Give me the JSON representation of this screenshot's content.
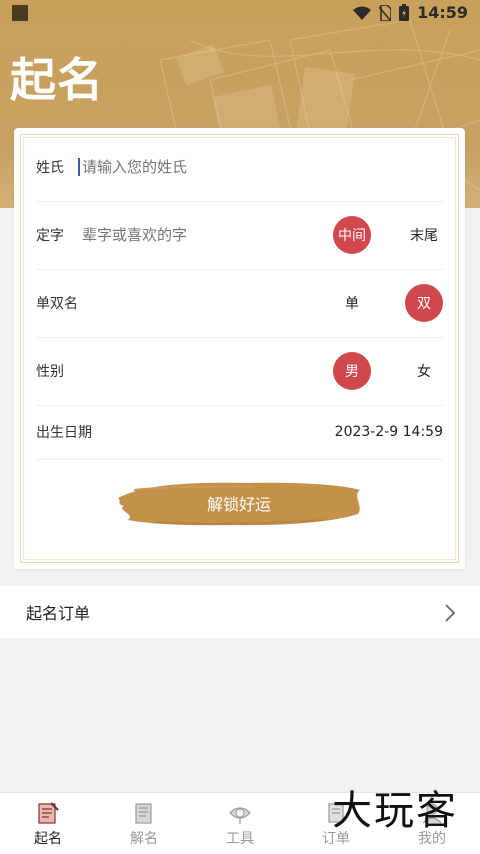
{
  "status_bar": {
    "time": "14:59"
  },
  "header": {
    "title": "起名"
  },
  "form": {
    "surname": {
      "label": "姓氏",
      "placeholder": "请输入您的姓氏"
    },
    "fixed_char": {
      "label": "定字",
      "placeholder": "辈字或喜欢的字",
      "options": [
        "中间",
        "末尾"
      ],
      "selected": "中间"
    },
    "name_length": {
      "label": "单双名",
      "options": [
        "单",
        "双"
      ],
      "selected": "双"
    },
    "gender": {
      "label": "性别",
      "options": [
        "男",
        "女"
      ],
      "selected": "男"
    },
    "birth": {
      "label": "出生日期",
      "value": "2023-2-9 14:59"
    },
    "submit_label": "解锁好运"
  },
  "orders": {
    "label": "起名订单"
  },
  "tabs": [
    {
      "label": "起名",
      "icon": "naming-scroll-icon",
      "active": true
    },
    {
      "label": "解名",
      "icon": "book-icon",
      "active": false
    },
    {
      "label": "工具",
      "icon": "compass-icon",
      "active": false
    },
    {
      "label": "订单",
      "icon": "order-icon",
      "active": false
    },
    {
      "label": "我的",
      "icon": "profile-icon",
      "active": false
    }
  ],
  "watermark": {
    "text": "大玩客"
  },
  "colors": {
    "accent": "#d0484c",
    "header_gold": "#c9a05a",
    "brush_gold": "#c4914a"
  }
}
